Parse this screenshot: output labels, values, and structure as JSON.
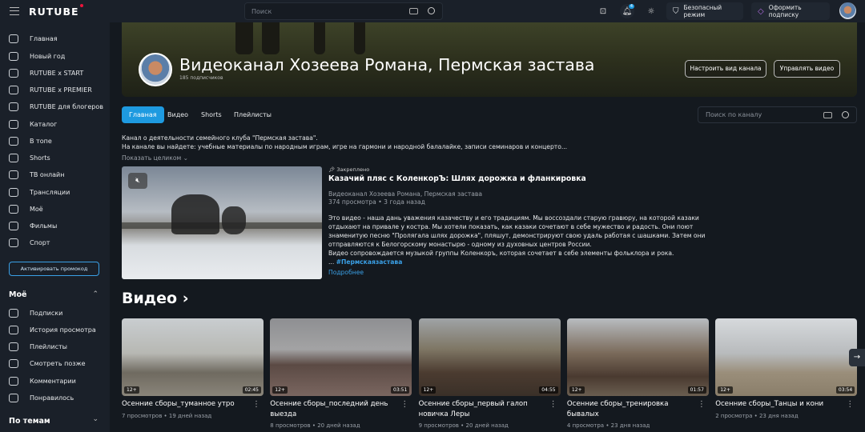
{
  "header": {
    "logo": "RUTUBE",
    "search_placeholder": "Поиск",
    "notif_count": "4",
    "safe_mode": "Безопасный режим",
    "subscribe": "Оформить подписку"
  },
  "sidebar": {
    "items": [
      {
        "label": "Главная",
        "icon": "home-icon"
      },
      {
        "label": "Новый год",
        "icon": "tree-icon"
      },
      {
        "label": "RUTUBE x START",
        "icon": "start-icon"
      },
      {
        "label": "RUTUBE x PREMIER",
        "icon": "premier-icon"
      },
      {
        "label": "RUTUBE для блогеров",
        "icon": "bloggers-icon"
      },
      {
        "label": "Каталог",
        "icon": "catalog-icon"
      },
      {
        "label": "В топе",
        "icon": "top-icon"
      },
      {
        "label": "Shorts",
        "icon": "shorts-icon"
      },
      {
        "label": "ТВ онлайн",
        "icon": "tv-icon"
      },
      {
        "label": "Трансляции",
        "icon": "broadcast-icon"
      },
      {
        "label": "Моё",
        "icon": "my-icon"
      },
      {
        "label": "Фильмы",
        "icon": "films-icon"
      },
      {
        "label": "Спорт",
        "icon": "sport-icon"
      }
    ],
    "promo": "Активировать промокод",
    "my_title": "Моё",
    "my_items": [
      {
        "label": "Подписки",
        "icon": "subscriptions-icon"
      },
      {
        "label": "История просмотра",
        "icon": "history-icon"
      },
      {
        "label": "Плейлисты",
        "icon": "playlists-icon"
      },
      {
        "label": "Смотреть позже",
        "icon": "watch-later-icon"
      },
      {
        "label": "Комментарии",
        "icon": "comments-icon"
      },
      {
        "label": "Понравилось",
        "icon": "like-icon"
      }
    ],
    "topics_title": "По темам"
  },
  "channel": {
    "title": "Видеоканал Хозеева Романа, Пермская застава",
    "subscribers": "185 подписчиков",
    "customize": "Настроить вид канала",
    "manage": "Управлять видео",
    "tabs": [
      "Главная",
      "Видео",
      "Shorts",
      "Плейлисты"
    ],
    "search_placeholder": "Поиск по каналу",
    "desc1": "Канал о деятельности семейного клуба \"Пермская застава\".",
    "desc2": "На канале вы найдете: учебные материалы по народным играм, игре на гармони и народной балалайке, записи семинаров и концерто...",
    "show_all": "Показать целиком"
  },
  "pinned": {
    "label": "Закреплено",
    "title": "Казачий пляс с КоленкорЪ: Шлях дорожка и фланкировка",
    "author": "Видеоканал Хозеева Романа, Пермская застава",
    "meta": "374 просмотра • 3 года назад",
    "text": [
      "Это видео - наша дань уважения казачеству и его традициям. Мы воссоздали старую гравюру, на которой казаки",
      "отдыхают на привале у костра. Мы хотели показать, как казаки сочетают в себе мужество и радость. Они поют",
      "знаменитую песню \"Пролягала шлях дорожка\", пляшут, демонстрируют свою удаль работая с шашками. Затем они",
      "отправляются к Белогорскому монастырю - одному из духовных центров России.",
      "Видео сопровождается музыкой группы Коленкоръ, которая сочетает в себе элементы фольклора и рока."
    ],
    "ellipsis": "...",
    "hashtag": "#Пермскаязастава",
    "more": "Подробнее"
  },
  "videos": {
    "heading": "Видео",
    "items": [
      {
        "title": "Осенние сборы_туманное утро",
        "meta": "7 просмотров • 19 дней назад",
        "age": "12+",
        "duration": "02:45"
      },
      {
        "title": "Осенние сборы_последний день выезда",
        "meta": "8 просмотров • 20 дней назад",
        "age": "12+",
        "duration": "03:51"
      },
      {
        "title": "Осенние сборы_первый галоп новичка Леры",
        "meta": "9 просмотров • 20 дней назад",
        "age": "12+",
        "duration": "04:55"
      },
      {
        "title": "Осенние сборы_тренировка бывалых",
        "meta": "4 просмотра • 23 дня назад",
        "age": "12+",
        "duration": "01:57"
      },
      {
        "title": "Осенние сборы_Танцы и кони",
        "meta": "2 просмотра • 23 дня назад",
        "age": "12+",
        "duration": "03:54"
      }
    ]
  }
}
